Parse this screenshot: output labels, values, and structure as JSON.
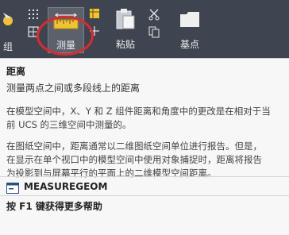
{
  "ribbon": {
    "group_label_left": "组",
    "measure_label": "测量",
    "paste_label": "粘贴",
    "base_point_label": "基点",
    "icons": {
      "left_tool": "pointer-tool-icon",
      "dot_grid": "dot-grid-icon",
      "measure": "ruler-icon",
      "paste": "clipboard-icon",
      "cut": "scissors-icon",
      "base_point": "base-point-icon"
    }
  },
  "tooltip": {
    "title": "距离",
    "subtitle": "测量两点之间或多段线上的距离",
    "paragraph_1_line_1": "在模型空间中，X、Y 和 Z 组件距离和角度中的更改是在相对于当",
    "paragraph_1_line_2": "前 UCS 的三维空间中测量的。",
    "paragraph_2_line_1": "在图纸空间中，距离通常以二维图纸空间单位进行报告。但是，",
    "paragraph_2_line_2": "在显示在单个视口中的模型空间中使用对象捕捉时，距离将报告",
    "paragraph_2_line_3": "为投影到与屏幕平行的平面上的二维模型空间距离。",
    "command_name": "MEASUREGEOM",
    "help_text": "按 F1 键获得更多帮助"
  },
  "colors": {
    "ribbon_bg": "#3f4550",
    "highlight_circle": "#e0282e",
    "ruler_yellow": "#f2c230"
  }
}
